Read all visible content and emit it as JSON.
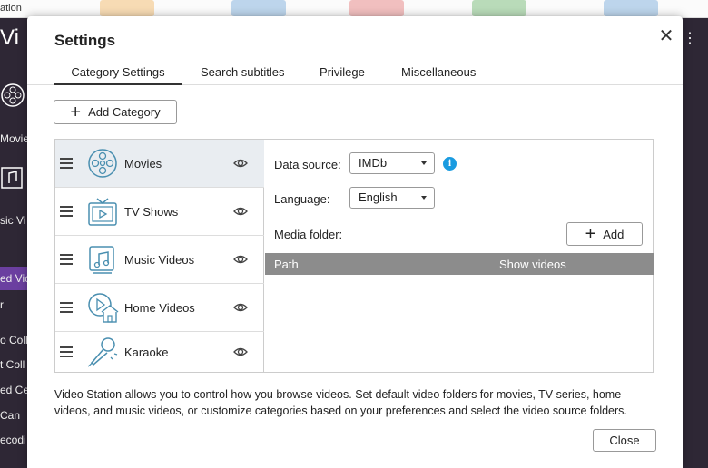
{
  "background": {
    "topbar_text": "ation",
    "sidebar_items": [
      "Vi",
      "Movie",
      "sic Vi",
      "ed Vic",
      "r",
      "o Coll",
      "t Coll",
      "ed Ce",
      "Can",
      "ecodi"
    ],
    "colors": {
      "sidebar": "#2e2735",
      "highlight": "#6b3fa0"
    }
  },
  "dialog": {
    "title": "Settings",
    "close_icon": "close-icon",
    "tabs": [
      {
        "label": "Category Settings",
        "active": true
      },
      {
        "label": "Search subtitles",
        "active": false
      },
      {
        "label": "Privilege",
        "active": false
      },
      {
        "label": "Miscellaneous",
        "active": false
      }
    ],
    "add_category_label": "Add Category",
    "categories": [
      {
        "label": "Movies",
        "icon": "film-reel-icon",
        "selected": true
      },
      {
        "label": "TV Shows",
        "icon": "tv-icon",
        "selected": false
      },
      {
        "label": "Music Videos",
        "icon": "music-video-icon",
        "selected": false
      },
      {
        "label": "Home Videos",
        "icon": "home-video-icon",
        "selected": false
      },
      {
        "label": "Karaoke",
        "icon": "microphone-icon",
        "selected": false
      }
    ],
    "detail": {
      "data_source_label": "Data source:",
      "data_source_value": "IMDb",
      "language_label": "Language:",
      "language_value": "English",
      "media_folder_label": "Media folder:",
      "add_label": "Add",
      "columns": [
        "Path",
        "Show videos"
      ]
    },
    "description": "Video Station allows you to control how you browse videos. Set default video folders for movies, TV series, home videos, and music videos, or customize categories based on your preferences and select the video source folders.",
    "close_button_label": "Close",
    "colors": {
      "accent": "#1a9be0",
      "icon": "#4a8fb0",
      "selected_row": "#e9edf1",
      "table_header": "#8c8c8c"
    }
  }
}
